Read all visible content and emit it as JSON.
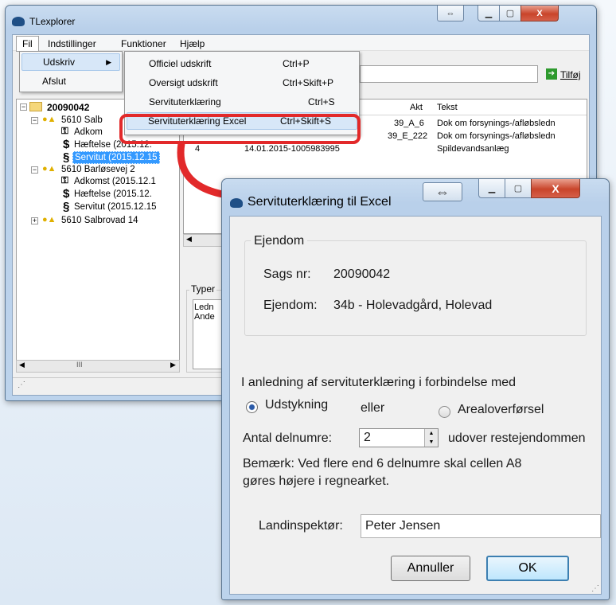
{
  "main_window": {
    "title": "TLexplorer",
    "menubar": [
      "Fil",
      "Indstillinger",
      "Funktioner",
      "Hjælp"
    ],
    "file_menu": [
      "Udskriv",
      "Afslut"
    ],
    "print_submenu": [
      {
        "label": "Officiel udskrift",
        "shortcut": "Ctrl+P"
      },
      {
        "label": "Oversigt udskrift",
        "shortcut": "Ctrl+Skift+P"
      },
      {
        "label": "Servituterklæring",
        "shortcut": "Ctrl+S"
      },
      {
        "label": "Servituterklæring Excel",
        "shortcut": "Ctrl+Skift+S"
      }
    ],
    "add_button": "Tilføj",
    "tree": {
      "root": "20090042",
      "p1": "5610 Salb",
      "p1_c1": "Adkom",
      "p1_c2": "Hæftelse (2015.12.",
      "p1_c3": "Servitut (2015.12.15",
      "p2": "5610 Barløsevej 2",
      "p2_c1": "Adkomst (2015.12.1",
      "p2_c2": "Hæftelse (2015.12.",
      "p2_c3": "Servitut (2015.12.15",
      "p3": "5610 Salbrovad 14"
    },
    "list": {
      "headers": {
        "akt": "Akt",
        "tekst": "Tekst"
      },
      "rows": [
        {
          "nr": "",
          "date": "",
          "akt": "39_A_6",
          "tekst": "Dok om forsynings-/afløbsledn"
        },
        {
          "nr": "",
          "date": "",
          "akt": "39_E_222",
          "tekst": "Dok om forsynings-/afløbsledn"
        },
        {
          "nr": "4",
          "date": "14.01.2015-1005983995",
          "akt": "",
          "tekst": "Spildevandsanlæg"
        }
      ]
    },
    "types_label": "Typer",
    "types_items": [
      "Ledn",
      "Ande"
    ],
    "scroll_dots": "III"
  },
  "dialog": {
    "title": "Servituterklæring til Excel",
    "group_label": "Ejendom",
    "sags_label": "Sags nr:",
    "sags_value": "20090042",
    "ejendom_label": "Ejendom:",
    "ejendom_value": "34b - Holevadgård, Holevad",
    "intro": "I anledning af servituterklæring i forbindelse med",
    "radio1": "Udstykning",
    "or_text": "eller",
    "radio2": "Arealoverførsel",
    "radio_selected": "Udstykning",
    "delnumre_label": "Antal delnumre:",
    "delnumre_value": "2",
    "delnumre_suffix": "udover restejendommen",
    "note_line1": "Bemærk: Ved flere end 6 delnumre skal cellen A8",
    "note_line2": "gøres højere i regnearket.",
    "landinspektor_label": "Landinspektør:",
    "landinspektor_value": "Peter Jensen",
    "cancel_button": "Annuller",
    "ok_button": "OK"
  },
  "colors": {
    "highlight": "#e2292a",
    "selection": "#3399ff",
    "menu_hover": "#d7e7f8"
  }
}
